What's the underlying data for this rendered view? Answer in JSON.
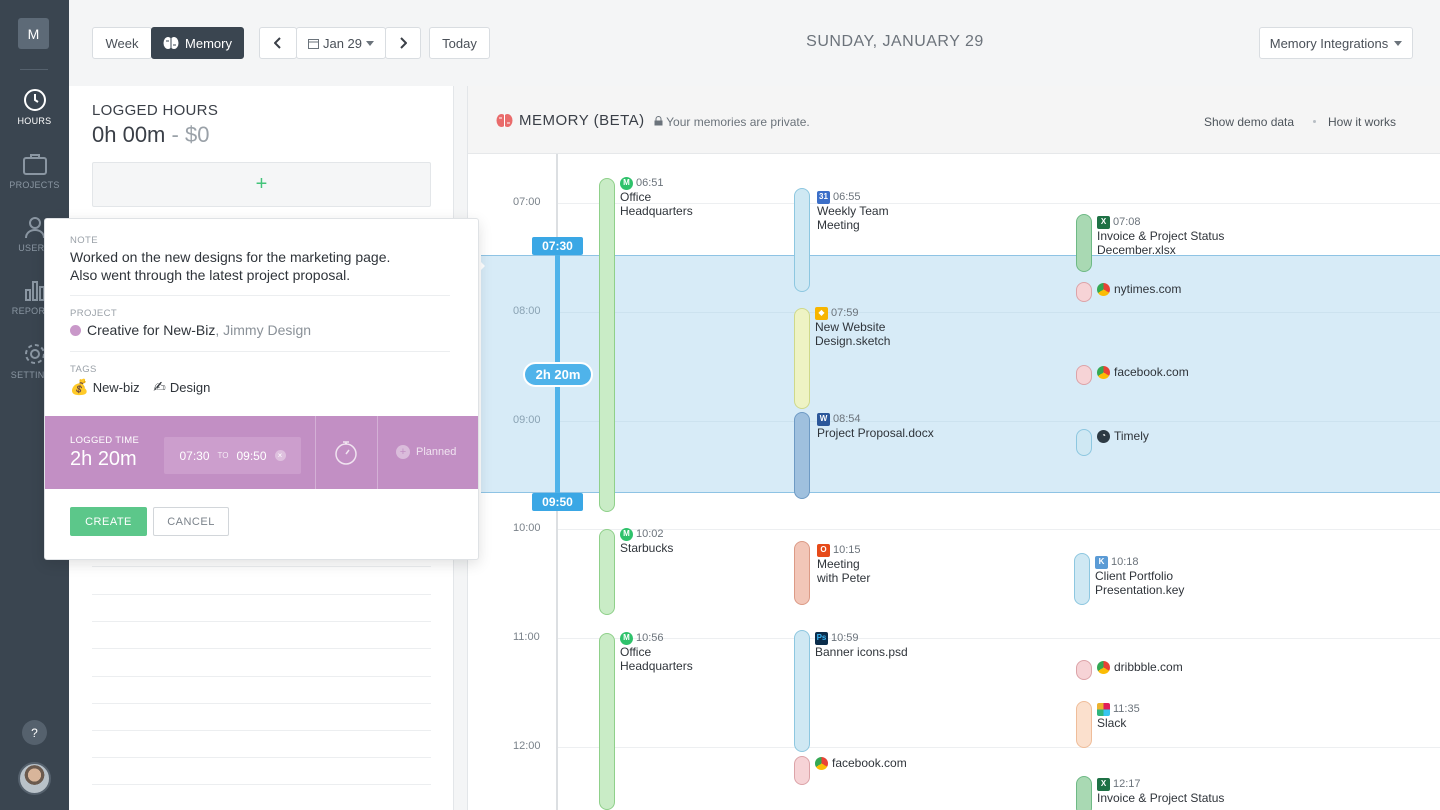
{
  "sidebar": {
    "logo": "M",
    "items": [
      {
        "label": "HOURS",
        "icon": "clock-icon"
      },
      {
        "label": "PROJECTS",
        "icon": "briefcase-icon"
      },
      {
        "label": "USERS",
        "icon": "user-icon"
      },
      {
        "label": "REPORTS",
        "icon": "bar-chart-icon"
      },
      {
        "label": "SETTINGS",
        "icon": "gear-icon"
      }
    ],
    "help": "?"
  },
  "toolbar": {
    "week": "Week",
    "memory": "Memory",
    "date": "Jan 29",
    "today": "Today",
    "integrations": "Memory Integrations"
  },
  "date_title": "SUNDAY, JANUARY 29",
  "logged": {
    "title": "LOGGED HOURS",
    "hours": "0h 00m",
    "sep": " - ",
    "money": "$0",
    "add": "+"
  },
  "popup": {
    "note_label": "NOTE",
    "note_line1": "Worked on the new designs for the marketing page.",
    "note_line2": "Also went through the latest project proposal.",
    "project_label": "PROJECT",
    "project_name": "Creative for New-Biz",
    "project_client": ", Jimmy Design",
    "project_color": "#c998c9",
    "tags_label": "TAGS",
    "tags": [
      {
        "icon": "💰",
        "label": "New-biz"
      },
      {
        "icon": "✍",
        "label": "Design"
      }
    ],
    "logged_time_label": "LOGGED TIME",
    "logged_h": "2h",
    "logged_m": "20m",
    "from": "07:30",
    "to_label": "TO",
    "to": "09:50",
    "clear": "×",
    "planned": "Planned",
    "create": "CREATE",
    "cancel": "CANCEL"
  },
  "memory": {
    "title": "MEMORY (BETA)",
    "private": "Your memories are private.",
    "show_demo": "Show demo data",
    "how_it_works": "How it works",
    "hours": [
      "07:00",
      "08:00",
      "09:00",
      "10:00",
      "11:00",
      "12:00"
    ],
    "selection": {
      "start": "07:30",
      "end": "09:50",
      "duration": "2h 20m"
    },
    "activities": [
      {
        "time": "06:51",
        "title1": "Office",
        "title2": "Headquarters",
        "app": "moves"
      },
      {
        "time": "06:55",
        "title1": "Weekly Team",
        "title2": "Meeting",
        "app": "calendar"
      },
      {
        "time": "07:08",
        "title1": "Invoice & Project Status",
        "title2": "December.xlsx",
        "app": "excel"
      },
      {
        "title1": "nytimes.com",
        "app": "chrome"
      },
      {
        "time": "07:59",
        "title1": "New Website",
        "title2": "Design.sketch",
        "app": "sketch"
      },
      {
        "title1": "facebook.com",
        "app": "chrome"
      },
      {
        "time": "08:54",
        "title1": "Project Proposal.docx",
        "app": "word"
      },
      {
        "title1": "Timely",
        "app": "timely"
      },
      {
        "time": "10:02",
        "title1": "Starbucks",
        "app": "moves"
      },
      {
        "time": "10:15",
        "title1": "Meeting",
        "title2": "with Peter",
        "app": "office"
      },
      {
        "time": "10:18",
        "title1": "Client Portfolio",
        "title2": "Presentation.key",
        "app": "keynote"
      },
      {
        "time": "10:56",
        "title1": "Office",
        "title2": "Headquarters",
        "app": "moves"
      },
      {
        "time": "10:59",
        "title1": "Banner icons.psd",
        "app": "photoshop"
      },
      {
        "title1": "dribbble.com",
        "app": "chrome"
      },
      {
        "time": "11:35",
        "title1": "Slack",
        "app": "slack"
      },
      {
        "title1": "facebook.com",
        "app": "chrome"
      },
      {
        "time": "12:17",
        "title1": "Invoice & Project Status",
        "app": "excel"
      }
    ]
  }
}
